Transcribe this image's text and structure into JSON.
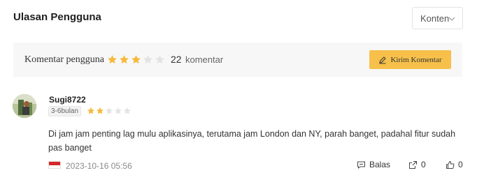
{
  "header": {
    "title": "Ulasan Pengguna"
  },
  "sort_dropdown": {
    "selected": "Konten",
    "icon": "chevron-down-icon"
  },
  "summary": {
    "label": "Komentar pengguna",
    "rating": 3,
    "max_rating": 5,
    "count": "22",
    "count_unit": "komentar",
    "write_button": {
      "label": "Kirim Komentar",
      "icon": "pencil-icon"
    }
  },
  "colors": {
    "accent": "#f6c04a",
    "star_filled": "#f6b93b",
    "star_empty": "#e3e3e3",
    "summary_bg": "#f7f7f7"
  },
  "reviews": [
    {
      "username": "Sugi8722",
      "duration": "3-6bulan",
      "rating": 2,
      "max_rating": 5,
      "text": "Di jam jam penting lag mulu aplikasinya, terutama jam London dan NY, parah banget, padahal fitur sudah pas banget",
      "country_icon": "indonesia-flag-icon",
      "timestamp": "2023-10-16 05:56",
      "actions": {
        "reply_label": "Balas",
        "share_count": "0",
        "like_count": "0"
      }
    }
  ]
}
